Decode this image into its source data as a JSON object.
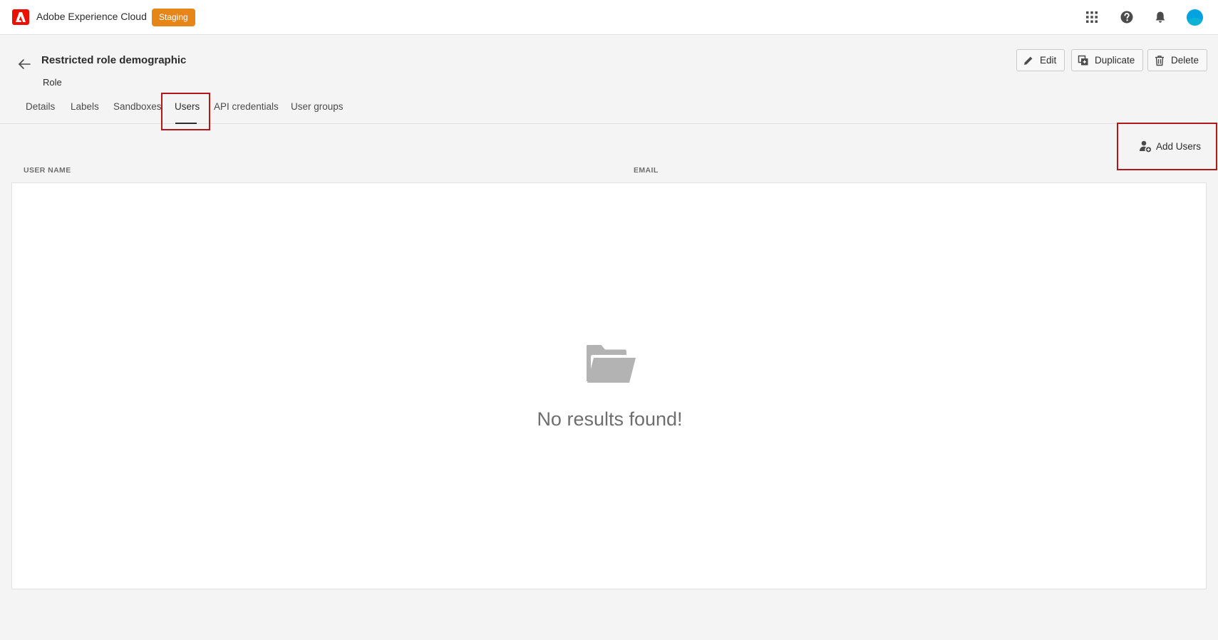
{
  "header": {
    "app_title": "Adobe Experience Cloud",
    "env_badge": "Staging",
    "icons": [
      "adobe-logo-icon",
      "app-switcher-icon",
      "help-icon",
      "notifications-icon",
      "avatar"
    ],
    "colors": {
      "brand": "#eb1000",
      "badge": "#e68619",
      "highlight": "#b3161b"
    }
  },
  "page": {
    "title": "Restricted role demographic",
    "subtitle": "Role",
    "actions": [
      {
        "label": "Edit",
        "icon": "pencil-icon"
      },
      {
        "label": "Duplicate",
        "icon": "duplicate-icon"
      },
      {
        "label": "Delete",
        "icon": "trash-icon"
      }
    ]
  },
  "tabs": [
    {
      "label": "Details"
    },
    {
      "label": "Labels"
    },
    {
      "label": "Sandboxes"
    },
    {
      "label": "Users",
      "active": true
    },
    {
      "label": "API credentials"
    },
    {
      "label": "User groups"
    }
  ],
  "users": {
    "add_label": "Add Users",
    "columns": [
      "USER NAME",
      "EMAIL"
    ],
    "rows": [],
    "empty_message": "No results found!"
  }
}
